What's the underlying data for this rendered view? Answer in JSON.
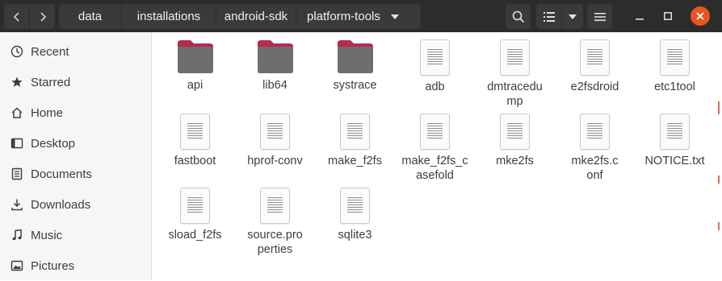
{
  "toolbar": {
    "breadcrumbs": [
      "data",
      "installations",
      "android-sdk",
      "platform-tools"
    ]
  },
  "sidebar": {
    "items": [
      {
        "label": "Recent",
        "icon": "clock-icon"
      },
      {
        "label": "Starred",
        "icon": "star-icon"
      },
      {
        "label": "Home",
        "icon": "home-icon"
      },
      {
        "label": "Desktop",
        "icon": "desktop-icon"
      },
      {
        "label": "Documents",
        "icon": "documents-icon"
      },
      {
        "label": "Downloads",
        "icon": "downloads-icon"
      },
      {
        "label": "Music",
        "icon": "music-icon"
      },
      {
        "label": "Pictures",
        "icon": "pictures-icon"
      }
    ]
  },
  "files": [
    {
      "name": "api",
      "kind": "folder"
    },
    {
      "name": "lib64",
      "kind": "folder"
    },
    {
      "name": "systrace",
      "kind": "folder"
    },
    {
      "name": "adb",
      "kind": "file"
    },
    {
      "name": "dmtracedump",
      "kind": "file"
    },
    {
      "name": "e2fsdroid",
      "kind": "file"
    },
    {
      "name": "etc1tool",
      "kind": "file"
    },
    {
      "name": "fastboot",
      "kind": "file"
    },
    {
      "name": "hprof-conv",
      "kind": "file"
    },
    {
      "name": "make_f2fs",
      "kind": "file"
    },
    {
      "name": "make_f2fs_casefold",
      "kind": "file"
    },
    {
      "name": "mke2fs",
      "kind": "file"
    },
    {
      "name": "mke2fs.conf",
      "kind": "file"
    },
    {
      "name": "NOTICE.txt",
      "kind": "file"
    },
    {
      "name": "sload_f2fs",
      "kind": "file"
    },
    {
      "name": "source.properties",
      "kind": "file"
    },
    {
      "name": "sqlite3",
      "kind": "file"
    }
  ],
  "colors": {
    "header_bg": "#2c2c2c",
    "button_bg": "#3a3a3a",
    "close_button": "#e95420",
    "folder_body": "#6e6e6e",
    "folder_tab": "#b8284f"
  }
}
